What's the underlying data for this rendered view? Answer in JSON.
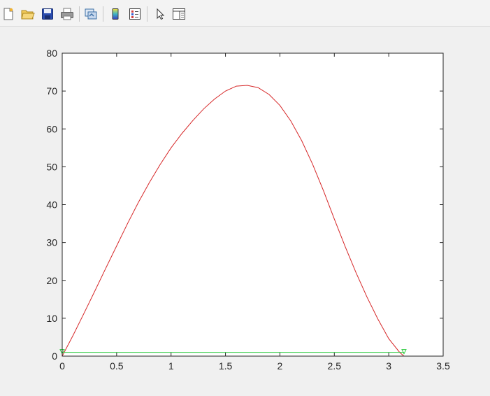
{
  "toolbar": {
    "buttons": [
      {
        "name": "new-figure-icon",
        "color": "#ffffff"
      },
      {
        "name": "open-file-icon",
        "color": "#e8b838"
      },
      {
        "name": "save-icon",
        "color": "#2a4db0"
      },
      {
        "name": "print-icon",
        "color": "#7a7a7a"
      },
      {
        "name": "link-plot-icon",
        "color": "#3a6ea5"
      },
      {
        "name": "colorbar-icon",
        "color": "#3b7ddd"
      },
      {
        "name": "legend-icon",
        "color": "#d04040"
      },
      {
        "name": "edit-plot-arrow-icon",
        "color": "#333333"
      },
      {
        "name": "property-inspector-icon",
        "color": "#555555"
      }
    ]
  },
  "chart_data": {
    "type": "line",
    "title": "",
    "xlabel": "",
    "ylabel": "",
    "xlim": [
      0,
      3.5
    ],
    "ylim": [
      0,
      80
    ],
    "xticks": [
      "0",
      "0.5",
      "1",
      "1.5",
      "2",
      "2.5",
      "3",
      "3.5"
    ],
    "yticks": [
      "0",
      "10",
      "20",
      "30",
      "40",
      "50",
      "60",
      "70",
      "80"
    ],
    "grid": false,
    "series": [
      {
        "color": "#d62728",
        "x": [
          0,
          0.1,
          0.2,
          0.3,
          0.4,
          0.5,
          0.6,
          0.7,
          0.8,
          0.9,
          1.0,
          1.1,
          1.2,
          1.3,
          1.4,
          1.5,
          1.6,
          1.7,
          1.8,
          1.9,
          2.0,
          2.1,
          2.2,
          2.3,
          2.4,
          2.5,
          2.6,
          2.7,
          2.8,
          2.9,
          3.0,
          3.1,
          3.14
        ],
        "y": [
          0,
          5.5,
          11.3,
          17.2,
          23.2,
          29.1,
          35.0,
          40.6,
          45.8,
          50.6,
          55.0,
          58.8,
          62.2,
          65.3,
          67.9,
          70.0,
          71.3,
          71.5,
          70.9,
          69.1,
          66.2,
          62.1,
          56.9,
          50.7,
          43.7,
          36.2,
          28.9,
          22.0,
          15.6,
          9.8,
          4.6,
          1.0,
          0
        ]
      },
      {
        "color": "#2ecc40",
        "marker": "v",
        "x": [
          0,
          0.5,
          1.0,
          1.5,
          2.0,
          2.5,
          3.0,
          3.14
        ],
        "y": [
          1,
          1,
          1,
          1,
          1,
          1,
          1,
          1
        ]
      },
      {
        "color": "#e6c229",
        "x": [
          0,
          3.14
        ],
        "y": [
          0,
          0
        ]
      }
    ]
  }
}
